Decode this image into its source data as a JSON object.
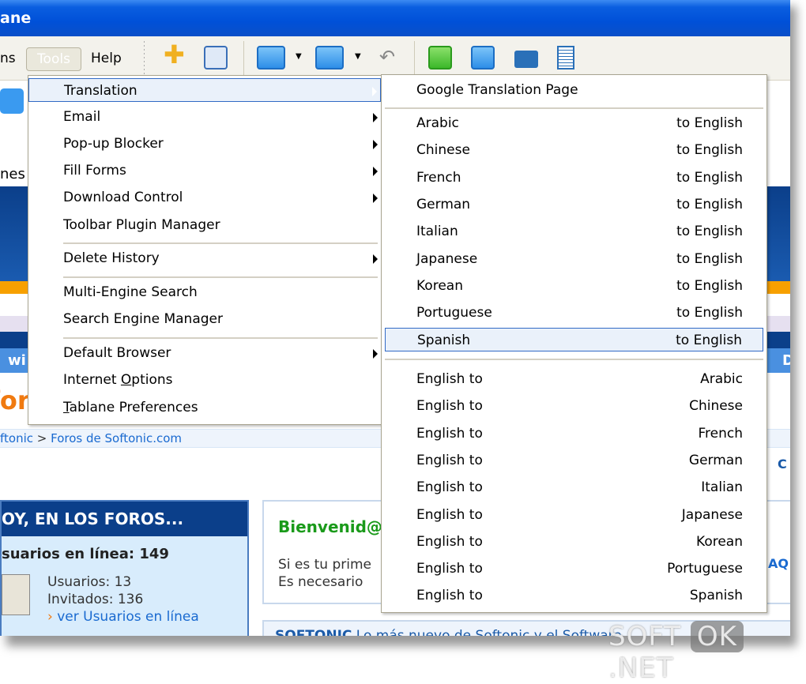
{
  "window": {
    "title": "ane"
  },
  "menubar": {
    "items": [
      "ns",
      "Tools",
      "Help"
    ]
  },
  "toolbar": {
    "icons": [
      "add-icon",
      "edit-icon",
      "minimize-tab-icon",
      "tile-icon",
      "undo-icon",
      "clock-icon",
      "copy-icon",
      "print-icon",
      "notepad-icon"
    ]
  },
  "tools_menu": {
    "groups": [
      [
        {
          "label": "Translation",
          "sub": true
        },
        {
          "label": "Email",
          "sub": true
        },
        {
          "label": "Pop-up Blocker",
          "sub": true
        },
        {
          "label": "Fill Forms",
          "sub": true
        },
        {
          "label": "Download Control",
          "sub": true
        },
        {
          "label": "Toolbar Plugin Manager",
          "sub": false
        }
      ],
      [
        {
          "label": "Delete History",
          "sub": true
        }
      ],
      [
        {
          "label": "Multi-Engine Search",
          "sub": false
        },
        {
          "label": "Search Engine Manager",
          "sub": false
        }
      ],
      [
        {
          "label": "Default Browser",
          "sub": true
        },
        {
          "label": "Internet Options",
          "sub": false
        },
        {
          "label": "Tablane Preferences",
          "sub": false
        }
      ]
    ]
  },
  "translation_menu": {
    "google": "Google Translation Page",
    "to_english": [
      "Arabic",
      "Chinese",
      "French",
      "German",
      "Italian",
      "Japanese",
      "Korean",
      "Portuguese",
      "Spanish"
    ],
    "to_english_suffix": "to English",
    "english_to_prefix": "English to",
    "english_to": [
      "Arabic",
      "Chinese",
      "French",
      "German",
      "Italian",
      "Japanese",
      "Korean",
      "Portuguese",
      "Spanish"
    ],
    "highlighted": "Spanish"
  },
  "page": {
    "nav_partial": "nes",
    "bar_partial": "wi",
    "bar_partial_right": "D",
    "logo_partial": "for",
    "breadcrumb": [
      "ftonic",
      ">",
      "Foros de Softonic.com"
    ],
    "forum_header": "OY, EN LOS FOROS...",
    "online": "suarios en línea: 149",
    "users": "Usuarios: 13",
    "guests": "Invitados: 136",
    "see_users": "ver Usuarios en línea",
    "welcome": "Bienvenid@",
    "welcome_l1": "Si es tu prime",
    "welcome_l2": "Es necesario",
    "softonic_bar": "SOFTONIC",
    "softonic_text": "Lo más nuevo de Softonic y el Software",
    "right_c": "C",
    "right_aq": "AQ"
  },
  "watermark": "SOFT OK .NET"
}
